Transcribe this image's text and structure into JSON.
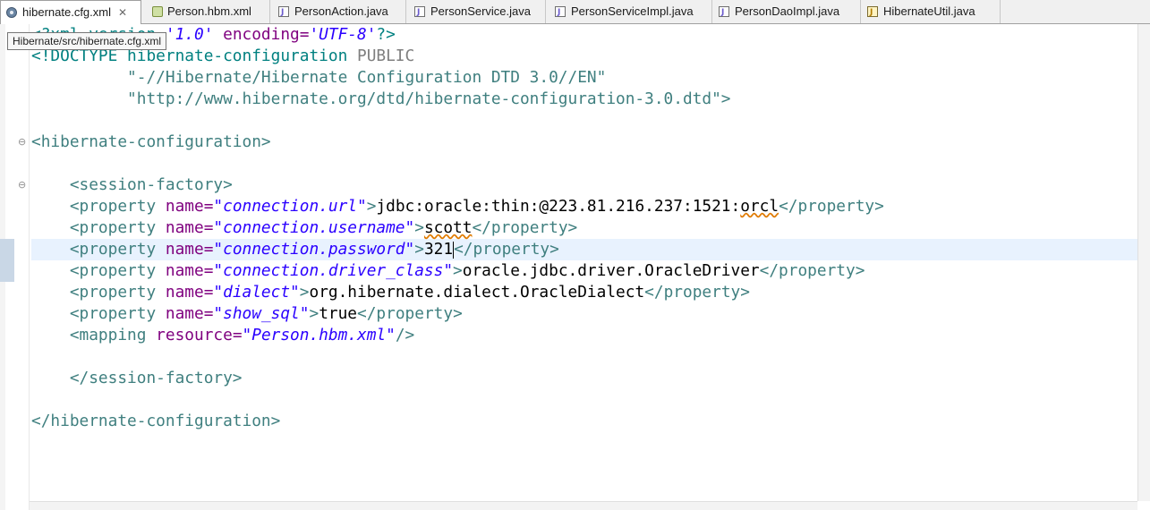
{
  "tabs": [
    {
      "label": "hibernate.cfg.xml",
      "icon": "xml-config-icon",
      "active": true,
      "closable": true
    },
    {
      "label": "Person.hbm.xml",
      "icon": "hbm-file-icon"
    },
    {
      "label": "PersonAction.java",
      "icon": "java-file-icon"
    },
    {
      "label": "PersonService.java",
      "icon": "java-file-icon"
    },
    {
      "label": "PersonServiceImpl.java",
      "icon": "java-file-icon"
    },
    {
      "label": "PersonDaoImpl.java",
      "icon": "java-file-icon"
    },
    {
      "label": "HibernateUtil.java",
      "icon": "java-class-file-icon"
    }
  ],
  "close_glyph": "✕",
  "tooltip": "Hibernate/src/hibernate.cfg.xml",
  "editor": {
    "lines": [
      {
        "tokens": [
          {
            "t": "<?xml version=",
            "c": "pi"
          },
          {
            "t": "'1.0'",
            "c": "str"
          },
          {
            "t": " encoding=",
            "c": "attr"
          },
          {
            "t": "'UTF-8'",
            "c": "str"
          },
          {
            "t": "?>",
            "c": "pi"
          }
        ]
      },
      {
        "tokens": [
          {
            "t": "<!DOCTYPE hibernate-configuration ",
            "c": "doctype"
          },
          {
            "t": "PUBLIC",
            "c": "kw"
          }
        ]
      },
      {
        "tokens": [
          {
            "t": "          \"-//Hibernate/Hibernate Configuration DTD 3.0//EN\"",
            "c": "dstr"
          }
        ]
      },
      {
        "tokens": [
          {
            "t": "          \"http://www.hibernate.org/dtd/hibernate-configuration-3.0.dtd\">",
            "c": "dstr"
          }
        ]
      },
      {
        "tokens": []
      },
      {
        "fold": true,
        "tokens": [
          {
            "t": "<hibernate-configuration>",
            "c": "tag"
          }
        ]
      },
      {
        "tokens": []
      },
      {
        "fold": true,
        "tokens": [
          {
            "t": "    <session-factory>",
            "c": "tag"
          }
        ]
      },
      {
        "tokens": [
          {
            "t": "    <property ",
            "c": "tag"
          },
          {
            "t": "name=",
            "c": "attr"
          },
          {
            "t": "\"connection.url\"",
            "c": "str"
          },
          {
            "t": ">",
            "c": "tag"
          },
          {
            "t": "jdbc:oracle:thin:@223.81.216.237:1521:",
            "c": "text"
          },
          {
            "t": "orcl",
            "c": "text",
            "sq": true
          },
          {
            "t": "</property>",
            "c": "tag"
          }
        ]
      },
      {
        "tokens": [
          {
            "t": "    <property ",
            "c": "tag"
          },
          {
            "t": "name=",
            "c": "attr"
          },
          {
            "t": "\"connection.username\"",
            "c": "str"
          },
          {
            "t": ">",
            "c": "tag"
          },
          {
            "t": "scott",
            "c": "text",
            "sq": true
          },
          {
            "t": "</property>",
            "c": "tag"
          }
        ]
      },
      {
        "current": true,
        "tokens": [
          {
            "t": "    <property ",
            "c": "tag"
          },
          {
            "t": "name=",
            "c": "attr"
          },
          {
            "t": "\"connection.password\"",
            "c": "str"
          },
          {
            "t": ">",
            "c": "tag"
          },
          {
            "t": "321",
            "c": "text"
          },
          {
            "caret": true
          },
          {
            "t": "</property>",
            "c": "tag"
          }
        ]
      },
      {
        "tokens": [
          {
            "t": "    <property ",
            "c": "tag"
          },
          {
            "t": "name=",
            "c": "attr"
          },
          {
            "t": "\"connection.driver_class\"",
            "c": "str"
          },
          {
            "t": ">",
            "c": "tag"
          },
          {
            "t": "oracle.jdbc.driver.OracleDriver",
            "c": "text"
          },
          {
            "t": "</property>",
            "c": "tag"
          }
        ]
      },
      {
        "tokens": [
          {
            "t": "    <property ",
            "c": "tag"
          },
          {
            "t": "name=",
            "c": "attr"
          },
          {
            "t": "\"dialect\"",
            "c": "str"
          },
          {
            "t": ">",
            "c": "tag"
          },
          {
            "t": "org.hibernate.dialect.OracleDialect",
            "c": "text"
          },
          {
            "t": "</property>",
            "c": "tag"
          }
        ]
      },
      {
        "tokens": [
          {
            "t": "    <property ",
            "c": "tag"
          },
          {
            "t": "name=",
            "c": "attr"
          },
          {
            "t": "\"show_sql\"",
            "c": "str"
          },
          {
            "t": ">",
            "c": "tag"
          },
          {
            "t": "true",
            "c": "text"
          },
          {
            "t": "</property>",
            "c": "tag"
          }
        ]
      },
      {
        "tokens": [
          {
            "t": "    <mapping ",
            "c": "tag"
          },
          {
            "t": "resource=",
            "c": "attr"
          },
          {
            "t": "\"Person.hbm.xml\"",
            "c": "str"
          },
          {
            "t": "/>",
            "c": "tag"
          }
        ]
      },
      {
        "tokens": []
      },
      {
        "tokens": [
          {
            "t": "    </session-factory>",
            "c": "tag"
          }
        ]
      },
      {
        "tokens": []
      },
      {
        "tokens": [
          {
            "t": "</hibernate-configuration>",
            "c": "tag"
          }
        ]
      }
    ]
  },
  "colors": {
    "processing_instruction": "#008080",
    "attribute_name": "#7f007f",
    "attribute_value": "#2a00ff",
    "tag": "#3f7f7f",
    "content_text": "#000000",
    "current_line": "#e8f2fe"
  }
}
